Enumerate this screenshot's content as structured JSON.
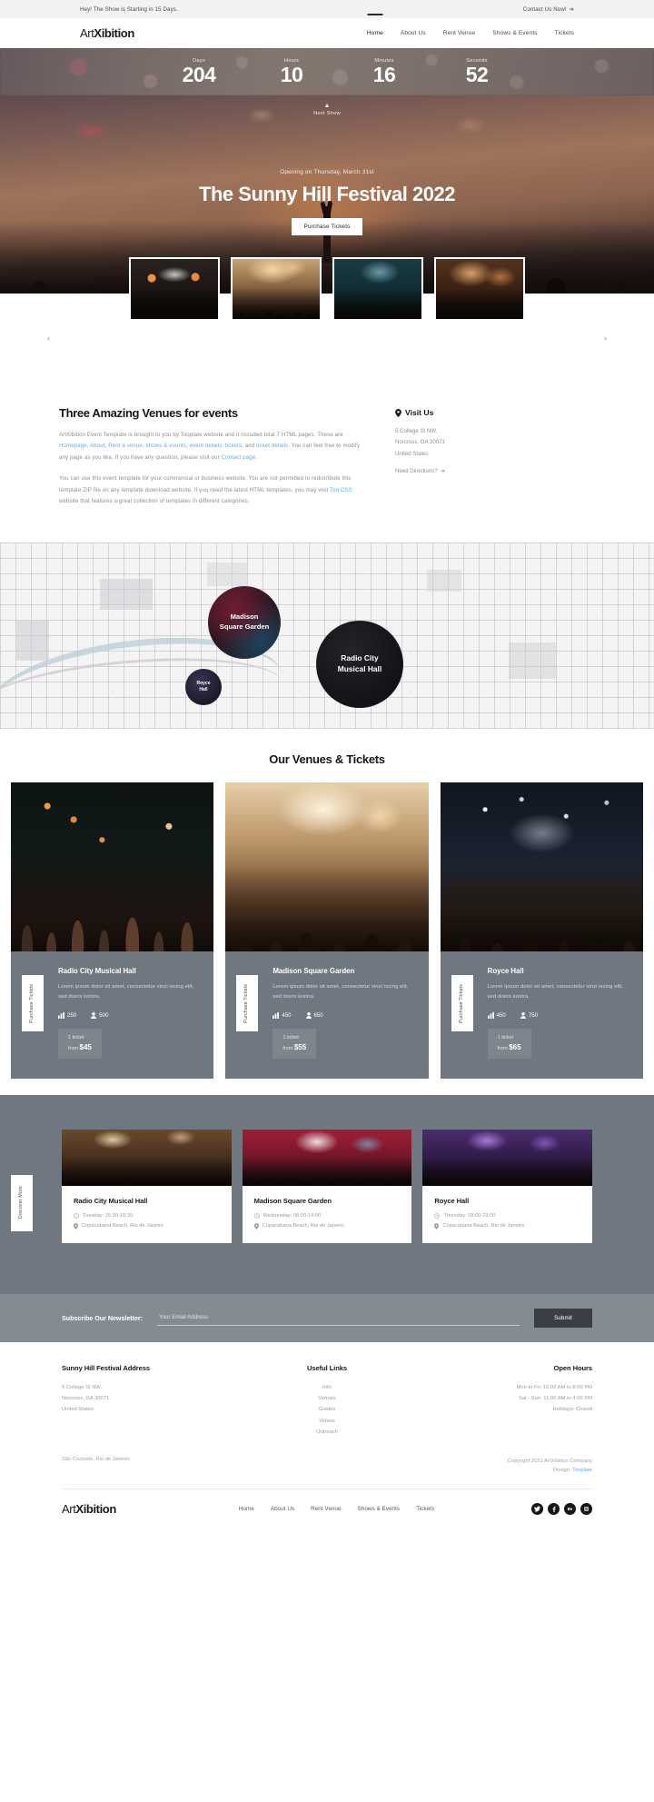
{
  "topbar": {
    "message": "Hey! The Show is Starting in 15 Days.",
    "cta": "Contact Us Now!",
    "cta_icon": "arrow-right-icon"
  },
  "navbar": {
    "brand_light": "Art",
    "brand_bold": "Xibition",
    "links": [
      {
        "label": "Home",
        "active": true
      },
      {
        "label": "About Us",
        "active": false
      },
      {
        "label": "Rent Venue",
        "active": false
      },
      {
        "label": "Shows & Events",
        "active": false
      },
      {
        "label": "Tickets",
        "active": false
      }
    ]
  },
  "countdown": {
    "items": [
      {
        "label": "Days",
        "value": "204"
      },
      {
        "label": "Hours",
        "value": "10"
      },
      {
        "label": "Minutes",
        "value": "16"
      },
      {
        "label": "Seconds",
        "value": "52"
      }
    ]
  },
  "hero": {
    "next_show_label": "Next Show",
    "next_show_icon": "chevron-up-icon",
    "opening": "Opening on Thursday, March 31st",
    "title": "The Sunny Hill Festival 2022",
    "button": "Purchase Tickets"
  },
  "carousel": {
    "prev_icon": "chevron-left-icon",
    "next_icon": "chevron-right-icon",
    "thumbs": [
      "concert-stage-thumb",
      "crowd-golden-thumb",
      "hands-up-thumb",
      "festival-lights-thumb"
    ]
  },
  "intro": {
    "heading": "Three Amazing Venues for events",
    "paragraph1_a": "ArtXibition Event Template is brought to you by Tooplate website and it included total 7 HTML pages. These are ",
    "links1": [
      "Homepage",
      "About",
      "Rent a venue",
      "shows & events",
      "event details",
      "tickets"
    ],
    "paragraph1_b": ", and ",
    "link1_last": "ticket details",
    "paragraph1_c": ". You can feel free to modify any page as you like. If you have any question, please visit our ",
    "link1_contact": "Contact page",
    "paragraph1_d": ".",
    "paragraph2_a": "You can use this event template for your commercial or business website. You are not permitted to redistribute this template ZIP file on any template download website. If you need the latest HTML templates, you may visit ",
    "link2": "Too CSS",
    "paragraph2_b": " website that features a great collection of templates in different categories."
  },
  "visit": {
    "pin_icon": "map-pin-icon",
    "heading": "Visit Us",
    "address_lines": [
      "5 College St NW,",
      "Norcross, GA 30071",
      "United States"
    ],
    "directions": "Need Directions?",
    "directions_icon": "arrow-right-icon"
  },
  "map": {
    "pins": [
      {
        "name": "Madison Square Garden",
        "line1": "Madison",
        "line2": "Square Garden"
      },
      {
        "name": "Radio City Musical Hall",
        "line1": "Radio City",
        "line2": "Musical Hall"
      },
      {
        "name": "Royce Hall",
        "line1": "Royce",
        "line2": "Hall"
      }
    ]
  },
  "venues": {
    "title": "Our Venues & Tickets",
    "purchase_label": "Purchase Tickets",
    "cards": [
      {
        "title": "Radio City Musical Hall",
        "desc": "Lorem ipsum dolor sit amet, consectetur vinzi iscing elit, sed doers kontra.",
        "stat_seats_icon": "seats-icon",
        "stat_seats": "250",
        "stat_people_icon": "person-icon",
        "stat_people": "500",
        "ticket_label": "1 ticket",
        "from_label": "from",
        "price": "$45"
      },
      {
        "title": "Madison Square Garden",
        "desc": "Lorem ipsum dolor sit amet, consectetur vinzi iscing elit, sed doers kontra.",
        "stat_seats_icon": "seats-icon",
        "stat_seats": "450",
        "stat_people_icon": "person-icon",
        "stat_people": "650",
        "ticket_label": "1 ticket",
        "from_label": "from",
        "price": "$55"
      },
      {
        "title": "Royce Hall",
        "desc": "Lorem ipsum dolor sit amet, consectetur vinzi iscing elit, sed doers kontra.",
        "stat_seats_icon": "seats-icon",
        "stat_seats": "450",
        "stat_people_icon": "person-icon",
        "stat_people": "750",
        "ticket_label": "1 ticket",
        "from_label": "from",
        "price": "$65"
      }
    ]
  },
  "events": {
    "discover_label": "Discover More",
    "cards": [
      {
        "title": "Radio City Musical Hall",
        "clock_icon": "clock-icon",
        "time": "Tuesday: 15:30-19:30",
        "pin_icon": "map-pin-icon",
        "location": "Copacabana Beach, Rio de Janeiro"
      },
      {
        "title": "Madison Square Garden",
        "clock_icon": "clock-icon",
        "time": "Wednesday: 08:00-14:00",
        "pin_icon": "map-pin-icon",
        "location": "Copacabana Beach, Rio de Janeiro"
      },
      {
        "title": "Royce Hall",
        "clock_icon": "clock-icon",
        "time": "Thursday: 09:00-23:00",
        "pin_icon": "map-pin-icon",
        "location": "Copacabana Beach, Rio de Janeiro"
      }
    ]
  },
  "newsletter": {
    "label": "Subscribe Our Newsletter:",
    "placeholder": "Your Email Address",
    "submit": "Submit"
  },
  "footer": {
    "address_heading": "Sunny Hill Festival Address",
    "address_lines": [
      "5 College St NW,",
      "Norcross, GA 30071",
      "United States"
    ],
    "links_heading": "Useful Links",
    "links": [
      "Info",
      "Venues",
      "Guides",
      "Videos",
      "Outreach"
    ],
    "hours_heading": "Open Hours",
    "hours": [
      "Mon to Fri: 10:00 AM to 8:00 PM",
      "Sat - Sun: 11:00 AM to 4:00 PM",
      "Holidays: Closed"
    ],
    "bottom_left": "São Conrado, Rio de Janeiro",
    "copyright": "Copyright 2021 ArtXibition Company",
    "design_prefix": "Design: ",
    "design_link": "Tooplate",
    "brand_light": "Art",
    "brand_bold": "Xibition",
    "nav": [
      "Home",
      "About Us",
      "Rent Venue",
      "Shows & Events",
      "Tickets"
    ],
    "socials": [
      "twitter-icon",
      "facebook-icon",
      "behance-icon",
      "instagram-icon"
    ]
  },
  "colors": {
    "accent_blue": "#6aa9e8",
    "slate": "#6f7780",
    "newsletter_bg": "#848b93",
    "submit_bg": "#3b3f45"
  }
}
